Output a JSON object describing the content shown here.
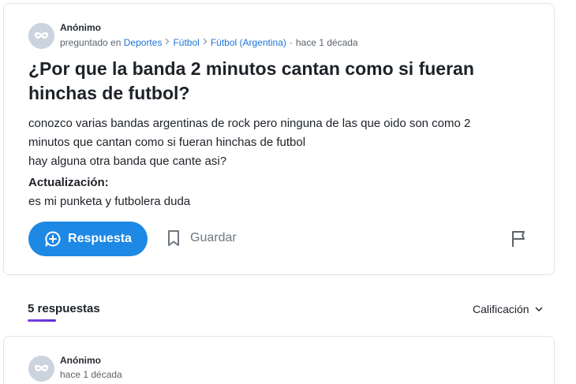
{
  "question": {
    "author": "Anónimo",
    "meta": {
      "prefix": "preguntado en",
      "breadcrumbs": [
        "Deportes",
        "Fútbol",
        "Fútbol (Argentina)"
      ],
      "time": "hace 1 década"
    },
    "title": "¿Por que la banda 2 minutos cantan como si fueran hinchas de futbol?",
    "body_lines": [
      "conozco varias bandas argentinas de rock pero ninguna de las que oido son como 2",
      "minutos que cantan como si fueran hinchas de futbol",
      "hay alguna otra banda que cante asi?"
    ],
    "update_label": "Actualización:",
    "update_text": "es mi punketa y futbolera duda",
    "actions": {
      "answer_label": "Respuesta",
      "save_label": "Guardar"
    }
  },
  "answers": {
    "count_label": "5 respuestas",
    "sort_label": "Calificación"
  },
  "first_answer": {
    "author": "Anónimo",
    "time": "hace 1 década"
  },
  "colors": {
    "accent": "#1e88e5",
    "link": "#1e73d8",
    "tab_underline": "#6a35dc"
  },
  "icons": [
    "anonymous-mask-icon",
    "chevron-right-icon",
    "chat-plus-icon",
    "bookmark-icon",
    "flag-icon",
    "chevron-down-icon"
  ]
}
